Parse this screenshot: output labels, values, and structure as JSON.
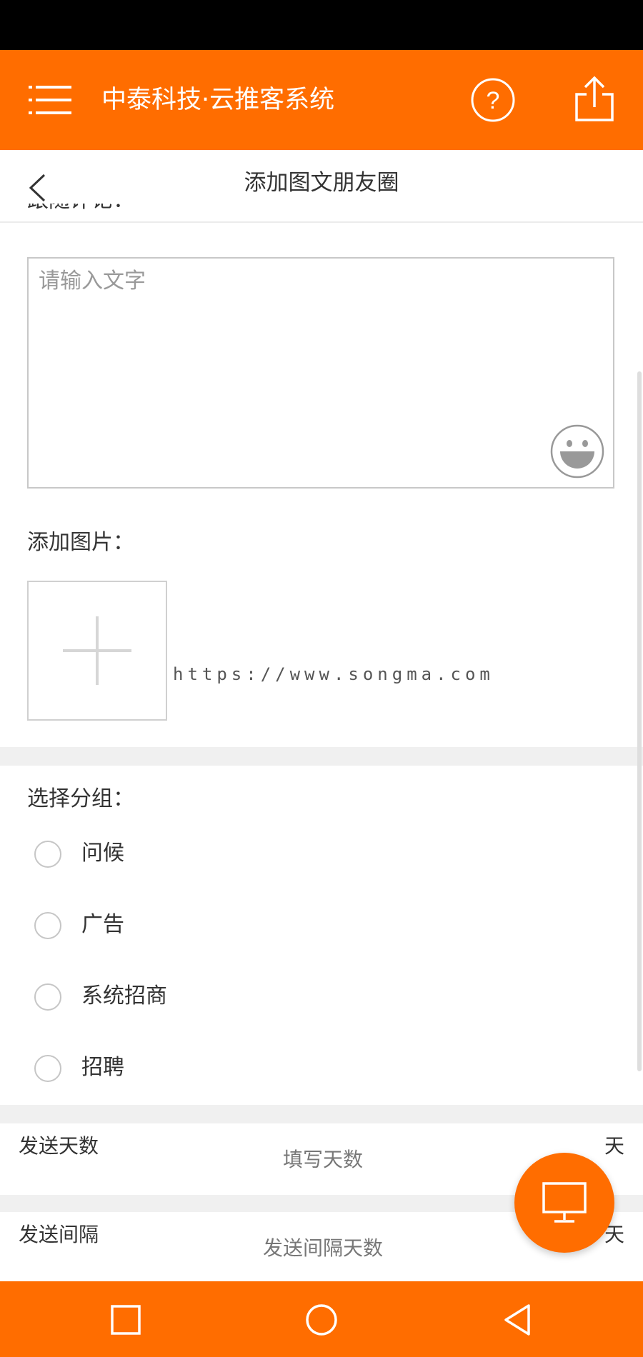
{
  "header": {
    "title": "中泰科技·云推客系统"
  },
  "nav": {
    "title": "添加图文朋友圈"
  },
  "follow_comment": {
    "label": "跟随评论：",
    "placeholder": "请输入文字"
  },
  "add_image": {
    "label": "添加图片："
  },
  "watermark": "https://www.songma.com",
  "group": {
    "label": "选择分组：",
    "options": [
      "问候",
      "广告",
      "系统招商",
      "招聘"
    ]
  },
  "send_days": {
    "label": "发送天数",
    "placeholder": "填写天数",
    "unit": "天"
  },
  "send_interval": {
    "label": "发送间隔",
    "placeholder": "发送间隔天数",
    "unit": "天"
  },
  "colors": {
    "brand": "#ff6d00",
    "divider": "#f0f0f0"
  },
  "icons": [
    "menu-icon",
    "help-icon",
    "share-icon",
    "back-icon",
    "emoji-icon",
    "plus-icon",
    "monitor-icon",
    "recent-apps-icon",
    "home-icon",
    "back-triangle-icon"
  ]
}
